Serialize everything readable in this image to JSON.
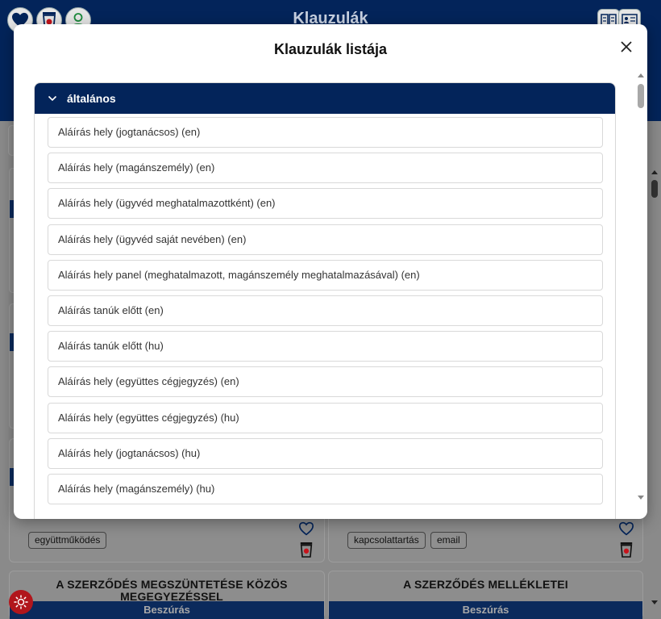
{
  "app": {
    "title": "Klauzulák",
    "theme_color": "#03245a",
    "accent_red": "#c8141c"
  },
  "background": {
    "tags": [
      "együttműködés",
      "kapcsolattartás",
      "email"
    ],
    "cards": [
      {
        "title": "A SZERZŐDÉS MEGSZÜNTETÉSE KÖZÖS MEGEGYEZÉSSEL",
        "button": "Beszúrás"
      },
      {
        "title": "A SZERZŐDÉS MELLÉKLETEI",
        "button": "Beszúrás"
      }
    ]
  },
  "modal": {
    "title": "Klauzulák listája",
    "close_icon": "close-icon",
    "category": {
      "label": "általános",
      "icon": "chevron-down-icon",
      "items": [
        "Aláírás hely (jogtanácsos) (en)",
        "Aláírás hely (magánszemély) (en)",
        "Aláírás hely (ügyvéd meghatalmazottként) (en)",
        "Aláírás hely (ügyvéd saját nevében) (en)",
        "Aláírás hely panel (meghatalmazott, magánszemély meghatalmazásával) (en)",
        "Aláírás tanúk előtt (en)",
        "Aláírás tanúk előtt (hu)",
        "Aláírás hely (együttes cégjegyzés) (en)",
        "Aláírás hely (együttes cégjegyzés) (hu)",
        "Aláírás hely (jogtanácsos) (hu)",
        "Aláírás hely (magánszemély) (hu)"
      ]
    }
  }
}
